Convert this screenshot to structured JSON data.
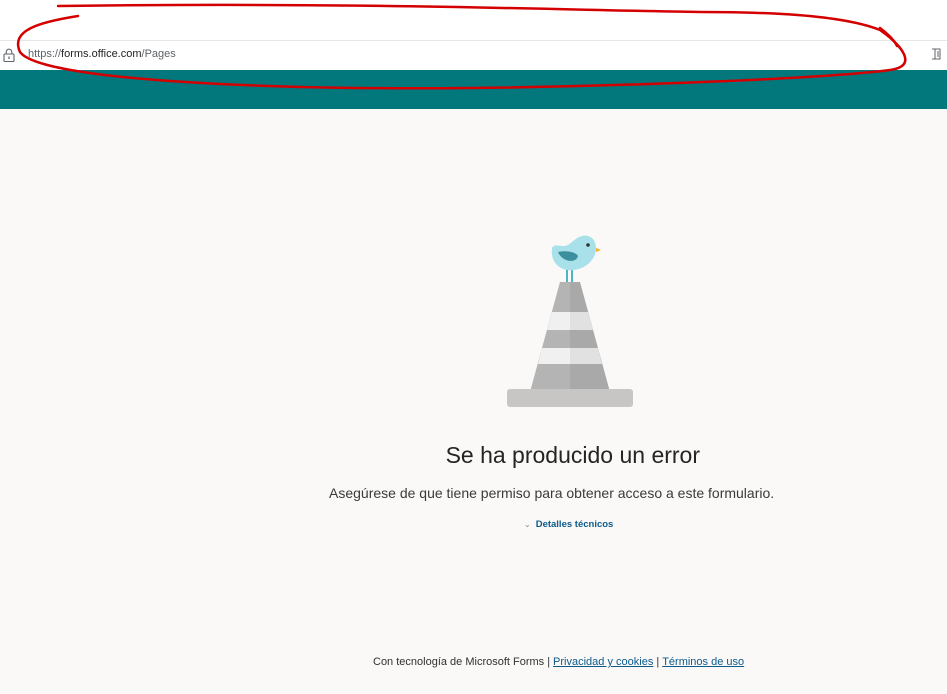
{
  "browser": {
    "url_prefix": "https://",
    "url_domain": "forms.office.com",
    "url_path": "/Pages"
  },
  "error": {
    "title": "Se ha producido un error",
    "message": "Asegúrese de que tiene permiso para obtener acceso a este formulario.",
    "details_label": "Detalles técnicos"
  },
  "footer": {
    "powered_by": "Con tecnología de Microsoft Forms",
    "separator": "|",
    "privacy_link": "Privacidad y cookies",
    "terms_link": "Términos de uso"
  },
  "colors": {
    "header_teal": "#03787c",
    "background": "#faf9f8",
    "link": "#0b5a8a",
    "annotation_red": "#d40000"
  },
  "icons": {
    "lock": "lock-icon",
    "reader": "reader-mode-icon",
    "chevron": "chevron-down-icon"
  }
}
